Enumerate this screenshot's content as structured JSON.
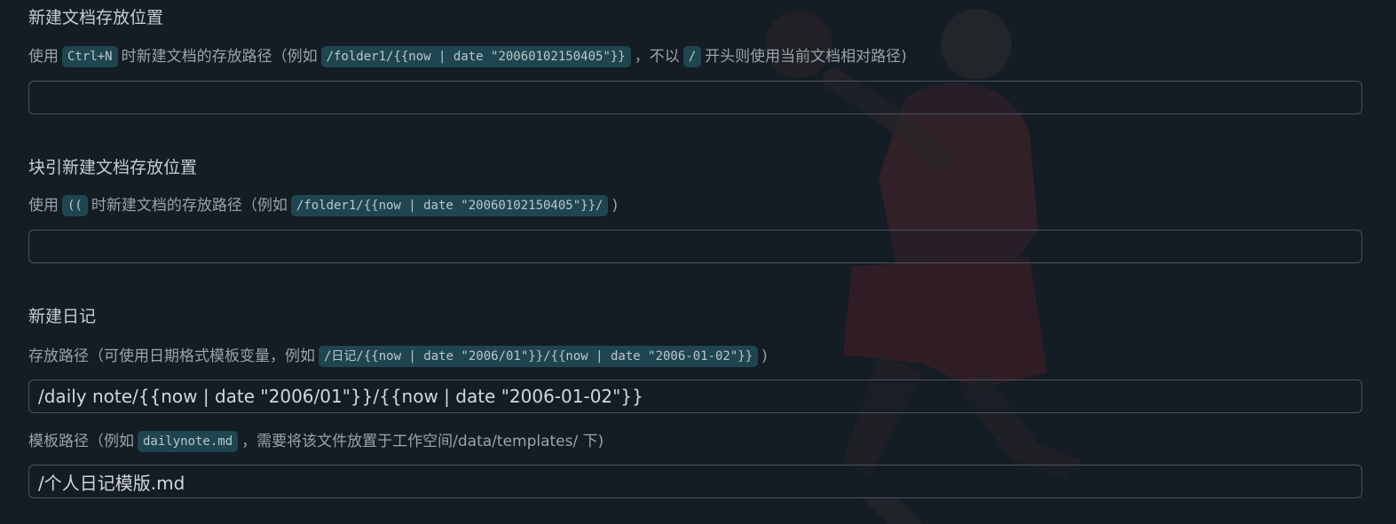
{
  "doc_location": {
    "title": "新建文档存放位置",
    "desc_part1": "使用",
    "shortcut": "Ctrl+N",
    "desc_part2": "时新建文档的存放路径（例如",
    "example": "/folder1/{{now | date \"20060102150405\"}}",
    "desc_part3": "，不以",
    "slash": "/",
    "desc_part4": "开头则使用当前文档相对路径)",
    "value": ""
  },
  "block_ref_location": {
    "title": "块引新建文档存放位置",
    "desc_part1": "使用",
    "shortcut": "((",
    "desc_part2": "时新建文档的存放路径（例如",
    "example": "/folder1/{{now | date \"20060102150405\"}}/",
    "desc_part3": ")",
    "value": ""
  },
  "daily_note": {
    "title": "新建日记",
    "path_desc_part1": "存放路径（可使用日期格式模板变量，例如",
    "path_example": "/日记/{{now | date \"2006/01\"}}/{{now | date \"2006-01-02\"}}",
    "path_desc_part2": ")",
    "path_value": "/daily note/{{now | date \"2006/01\"}}/{{now | date \"2006-01-02\"}}",
    "template_desc_part1": "模板路径（例如",
    "template_example": "dailynote.md",
    "template_desc_part2": "，需要将该文件放置于工作空间/data/templates/ 下)",
    "template_value": "/个人日记模版.md"
  }
}
